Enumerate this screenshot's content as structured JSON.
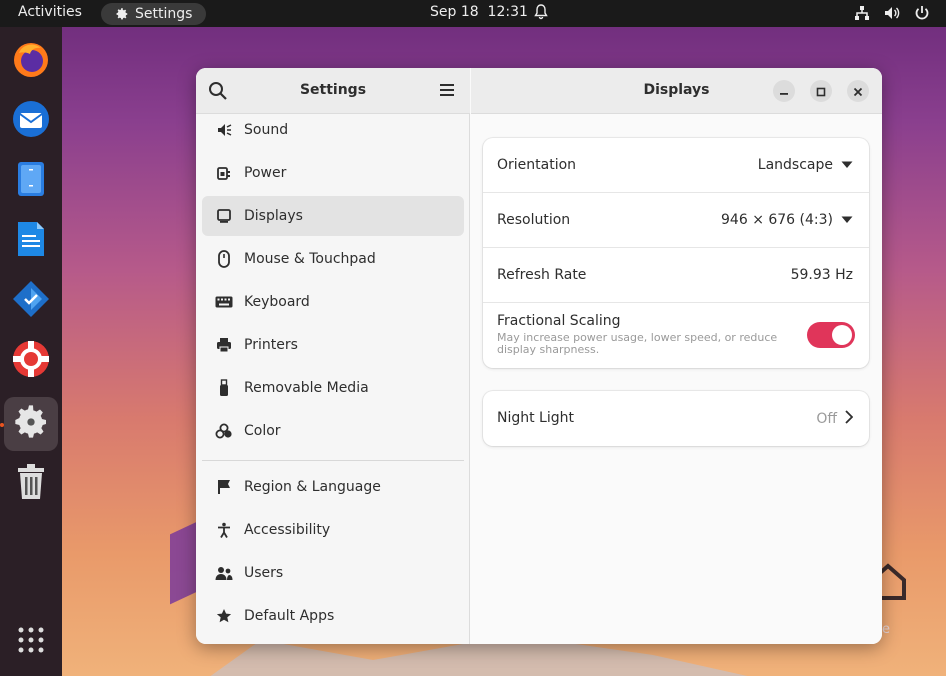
{
  "topbar": {
    "activities": "Activities",
    "app_name": "Settings",
    "datetime": "Sep 18  12:31",
    "tray_icons": [
      "network-icon",
      "volume-icon",
      "power-icon"
    ]
  },
  "dock": {
    "apps": [
      "firefox-icon",
      "thunderbird-icon",
      "files-icon",
      "writer-icon",
      "software-icon",
      "help-icon",
      "settings-icon",
      "trash-icon"
    ],
    "show_apps_icon": "app-grid-icon"
  },
  "desktop": {
    "home_label": "e"
  },
  "sidebar": {
    "title": "Settings",
    "items": [
      {
        "label": "Sound",
        "icon": "speaker-icon"
      },
      {
        "label": "Power",
        "icon": "power-plug-icon"
      },
      {
        "label": "Displays",
        "icon": "monitor-icon",
        "selected": true
      },
      {
        "label": "Mouse & Touchpad",
        "icon": "mouse-icon"
      },
      {
        "label": "Keyboard",
        "icon": "keyboard-icon"
      },
      {
        "label": "Printers",
        "icon": "printer-icon"
      },
      {
        "label": "Removable Media",
        "icon": "usb-icon"
      },
      {
        "label": "Color",
        "icon": "color-icon"
      },
      {
        "label": "Region & Language",
        "icon": "flag-icon"
      },
      {
        "label": "Accessibility",
        "icon": "accessibility-icon"
      },
      {
        "label": "Users",
        "icon": "users-icon"
      },
      {
        "label": "Default Apps",
        "icon": "star-icon"
      }
    ]
  },
  "content": {
    "title": "Displays",
    "orientation": {
      "label": "Orientation",
      "value": "Landscape"
    },
    "resolution": {
      "label": "Resolution",
      "value": "946 × 676 (4:3)"
    },
    "refresh_rate": {
      "label": "Refresh Rate",
      "value": "59.93 Hz"
    },
    "fractional_scaling": {
      "label": "Fractional Scaling",
      "description": "May increase power usage, lower speed, or reduce display sharpness.",
      "enabled": true
    },
    "night_light": {
      "label": "Night Light",
      "value": "Off"
    }
  },
  "colors": {
    "accent_toggle": "#e0355a",
    "dock_indicator": "#e95420"
  }
}
